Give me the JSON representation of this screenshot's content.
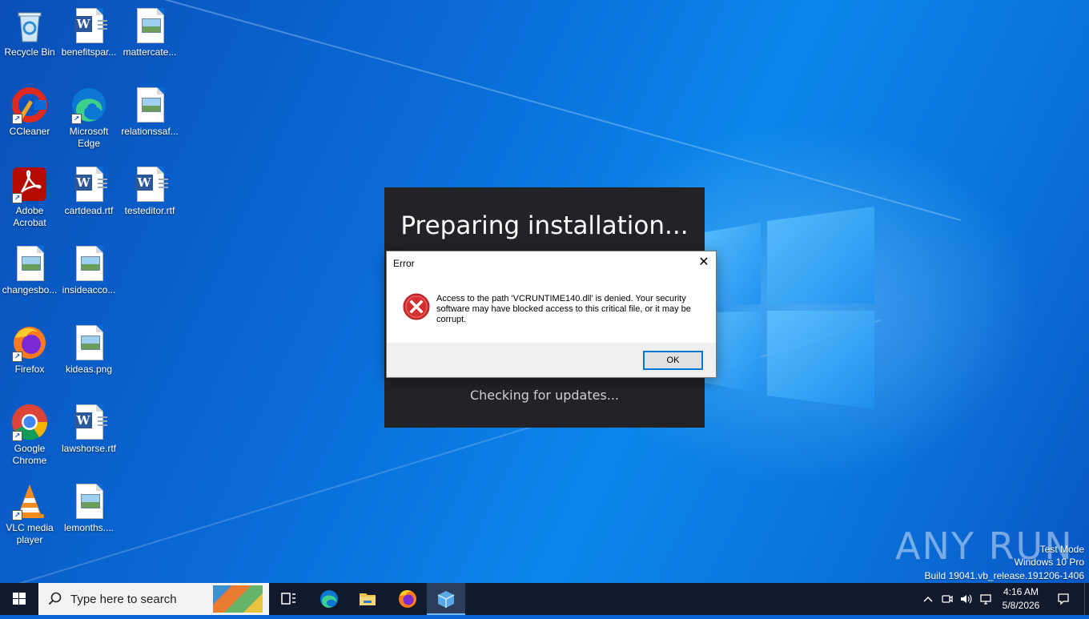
{
  "desktop": {
    "icons": [
      {
        "label": "Recycle Bin"
      },
      {
        "label": "benefitspar..."
      },
      {
        "label": "mattercate..."
      },
      {
        "label": "CCleaner"
      },
      {
        "label": "Microsoft Edge"
      },
      {
        "label": "relationssaf..."
      },
      {
        "label": "Adobe Acrobat"
      },
      {
        "label": "cartdead.rtf"
      },
      {
        "label": "testeditor.rtf"
      },
      {
        "label": "changesbo..."
      },
      {
        "label": "insideacco..."
      },
      {
        "label": "Firefox"
      },
      {
        "label": "kideas.png"
      },
      {
        "label": "Google Chrome"
      },
      {
        "label": "lawshorse.rtf"
      },
      {
        "label": "VLC media player"
      },
      {
        "label": "lemonths...."
      }
    ]
  },
  "installer": {
    "title": "Preparing installation...",
    "status": "Checking for updates..."
  },
  "error_dialog": {
    "title": "Error",
    "close_glyph": "✕",
    "message": "Access to the path 'VCRUNTIME140.dll' is denied. Your security software may have blocked access to this critical file, or it may be corrupt.",
    "ok_label": "OK"
  },
  "watermark": {
    "brand": "ANY RUN",
    "test_mode": "Test Mode",
    "edition": "Windows 10 Pro",
    "build": "Build 19041.vb_release.191206-1406"
  },
  "taskbar": {
    "search_placeholder": "Type here to search",
    "clock_time": "4:16 AM",
    "clock_date": "5/8/2026"
  },
  "colors": {
    "accent": "#0078d7",
    "taskbar": "#101a2c",
    "error_red": "#d32f2f"
  }
}
